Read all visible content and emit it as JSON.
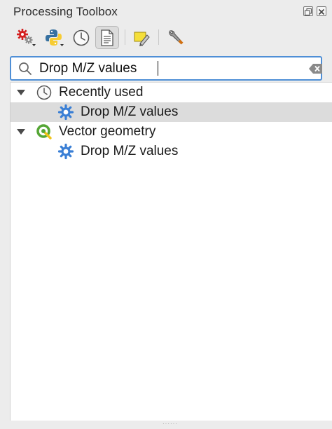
{
  "panel": {
    "title": "Processing Toolbox"
  },
  "toolbar": {
    "buttons": [
      {
        "name": "models",
        "icon": "models-gear-icon"
      },
      {
        "name": "scripts",
        "icon": "python-icon"
      },
      {
        "name": "history",
        "icon": "clock-history-icon"
      },
      {
        "name": "results",
        "icon": "results-document-icon"
      },
      {
        "name": "edit-features-in-place",
        "icon": "pencil-edit-icon"
      },
      {
        "name": "options",
        "icon": "wrench-icon"
      }
    ]
  },
  "search": {
    "value": "Drop M/Z values"
  },
  "tree": {
    "groups": [
      {
        "label": "Recently used",
        "icon": "clock-icon",
        "items": [
          {
            "label": "Drop M/Z values",
            "icon": "algorithm-gear-icon",
            "selected": true
          }
        ]
      },
      {
        "label": "Vector geometry",
        "icon": "qgis-logo-icon",
        "items": [
          {
            "label": "Drop M/Z values",
            "icon": "algorithm-gear-icon",
            "selected": false
          }
        ]
      }
    ]
  },
  "colors": {
    "focus_border": "#4f8fd6",
    "selection": "#dcdcdc",
    "gear_blue": "#3a7fd5",
    "qgis_green": "#55a635"
  }
}
